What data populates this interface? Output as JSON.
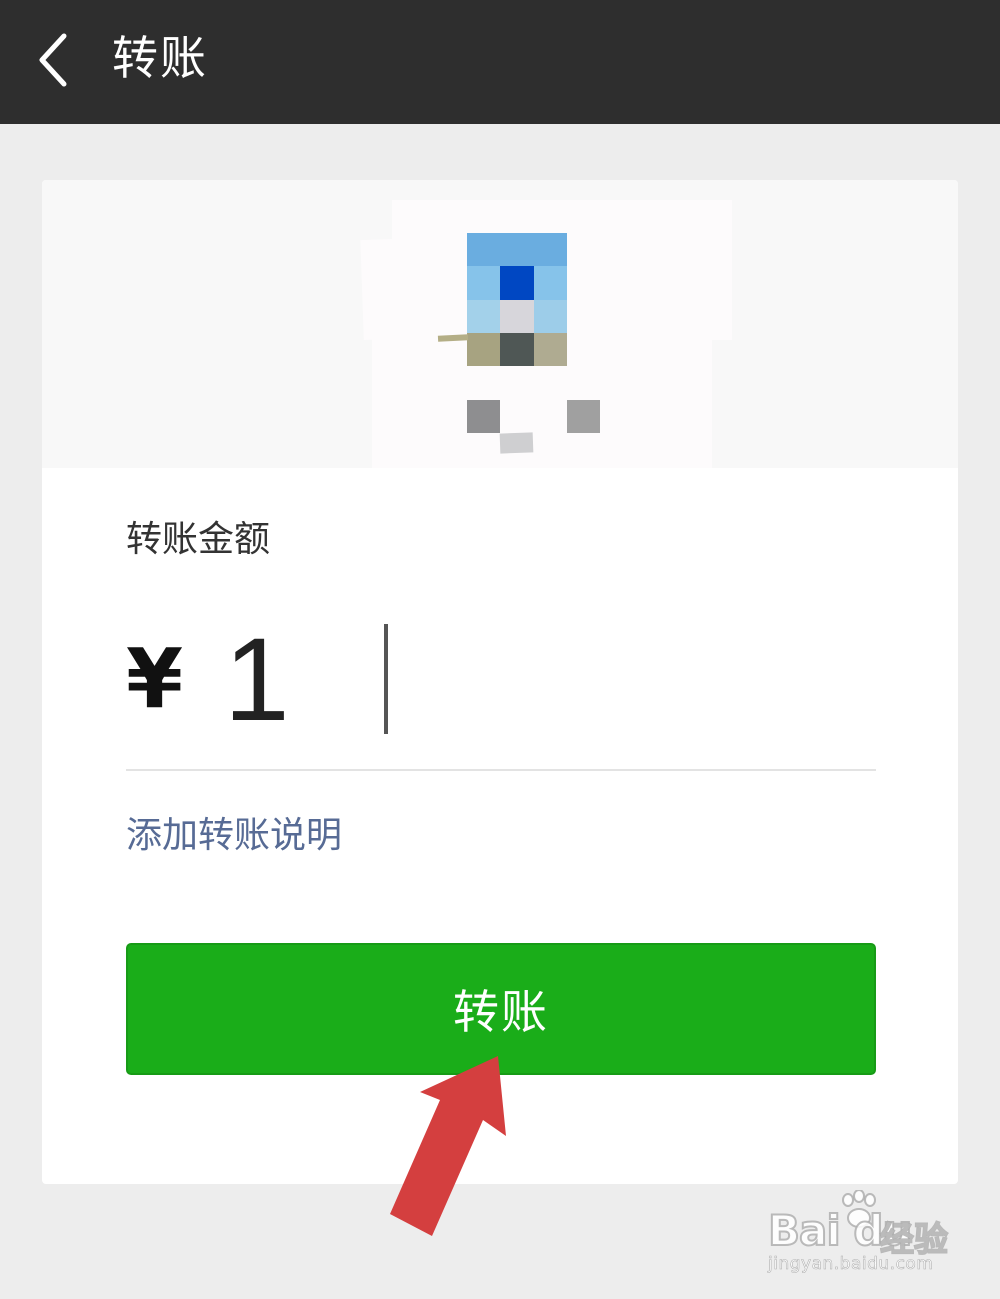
{
  "topbar": {
    "back_icon": "chevron-left-icon",
    "title": "转账"
  },
  "recipient": {
    "avatar_colors": [
      "#6aade0",
      "#6aade0",
      "#6aade0",
      "#86c3ea",
      "#0047c2",
      "#86c3ea",
      "#a3d1ea",
      "#d7d6db",
      "#9dcde9",
      "#a7a381",
      "#4f5755",
      "#afab91"
    ],
    "name_blocks_colors": [
      "#8e8e90",
      "#cfcfd1",
      "#a0a0a0"
    ]
  },
  "form": {
    "amount_label": "转账金额",
    "currency_symbol": "¥",
    "amount_value": "1",
    "add_note_label": "添加转账说明"
  },
  "actions": {
    "transfer_label": "转账"
  },
  "annotation": {
    "arrow_color": "#d43f3f"
  },
  "watermark": {
    "logo": "Bai du",
    "logo_cn": "经验",
    "url": "jingyan.baidu.com"
  },
  "colors": {
    "topbar": "#2e2e2e",
    "background": "#ededed",
    "accent_green": "#1aad19",
    "link_blue": "#576b95"
  }
}
